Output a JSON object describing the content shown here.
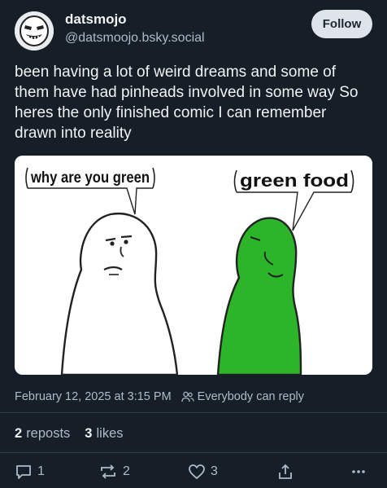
{
  "author": {
    "display_name": "datsmojo",
    "handle": "@datsmoojo.bsky.social"
  },
  "follow_label": "Follow",
  "post_text": "been having a lot of weird dreams  and some of them have had pinheads involved in some way  So heres the only finished comic I can remember drawn into reality",
  "comic": {
    "left_bubble": "why are you green",
    "right_bubble": "green food",
    "left_figure_color": "#ffffff",
    "right_figure_color": "#2db52a"
  },
  "meta": {
    "timestamp": "February 12, 2025 at 3:15 PM",
    "reply_setting": "Everybody can reply"
  },
  "stats": {
    "reposts_count": "2",
    "reposts_label": "reposts",
    "likes_count": "3",
    "likes_label": "likes"
  },
  "actions": {
    "reply_count": "1",
    "repost_count": "2",
    "like_count": "3"
  },
  "colors": {
    "background": "#161e27",
    "text_primary": "#f1f3f5",
    "text_secondary": "#aebbc9",
    "follow_button_bg": "#dfe4ea"
  }
}
